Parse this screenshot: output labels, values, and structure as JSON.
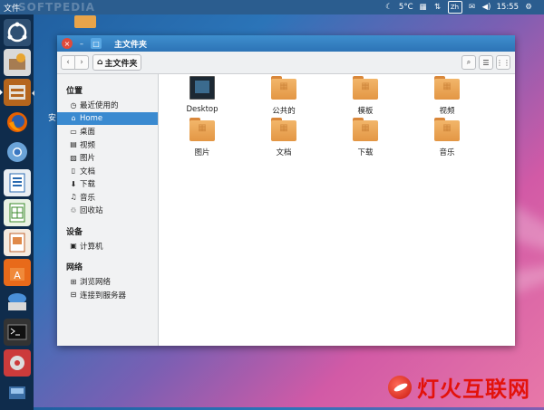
{
  "top_panel": {
    "app_title": "文件",
    "watermark": "SOFTPEDIA",
    "temperature": "5°C",
    "keyboard": "Zh",
    "time": "15:55"
  },
  "desktop": {
    "stray_text": "安"
  },
  "window": {
    "title": "主文件夹",
    "close_glyph": "×",
    "minimize_glyph": "–",
    "maximize_glyph": "□",
    "breadcrumb": "主文件夹",
    "back_glyph": "‹",
    "forward_glyph": "›"
  },
  "sidebar": {
    "sections": [
      {
        "title": "位置",
        "items": [
          {
            "label": "最近使用的",
            "icon": "clock-icon"
          },
          {
            "label": "Home",
            "icon": "home-icon",
            "selected": true
          },
          {
            "label": "桌面",
            "icon": "desktop-icon"
          },
          {
            "label": "视频",
            "icon": "film-icon"
          },
          {
            "label": "图片",
            "icon": "image-icon"
          },
          {
            "label": "文档",
            "icon": "document-icon"
          },
          {
            "label": "下载",
            "icon": "download-icon"
          },
          {
            "label": "音乐",
            "icon": "music-icon"
          },
          {
            "label": "回收站",
            "icon": "trash-icon"
          }
        ]
      },
      {
        "title": "设备",
        "items": [
          {
            "label": "计算机",
            "icon": "computer-icon"
          }
        ]
      },
      {
        "title": "网络",
        "items": [
          {
            "label": "浏览网络",
            "icon": "network-icon"
          },
          {
            "label": "连接到服务器",
            "icon": "server-icon"
          }
        ]
      }
    ]
  },
  "files": [
    {
      "label": "Desktop",
      "icon": "desktop-folder-icon"
    },
    {
      "label": "公共的",
      "icon": "folder-icon"
    },
    {
      "label": "模板",
      "icon": "folder-icon"
    },
    {
      "label": "视频",
      "icon": "folder-icon"
    },
    {
      "label": "图片",
      "icon": "folder-icon"
    },
    {
      "label": "文档",
      "icon": "folder-icon"
    },
    {
      "label": "下载",
      "icon": "folder-icon"
    },
    {
      "label": "音乐",
      "icon": "folder-icon"
    }
  ],
  "logo": {
    "text": "灯火互联网"
  },
  "colors": {
    "selection": "#3a8ad0",
    "folder": "#e8a44a",
    "titlebar": "#2d73b6"
  }
}
